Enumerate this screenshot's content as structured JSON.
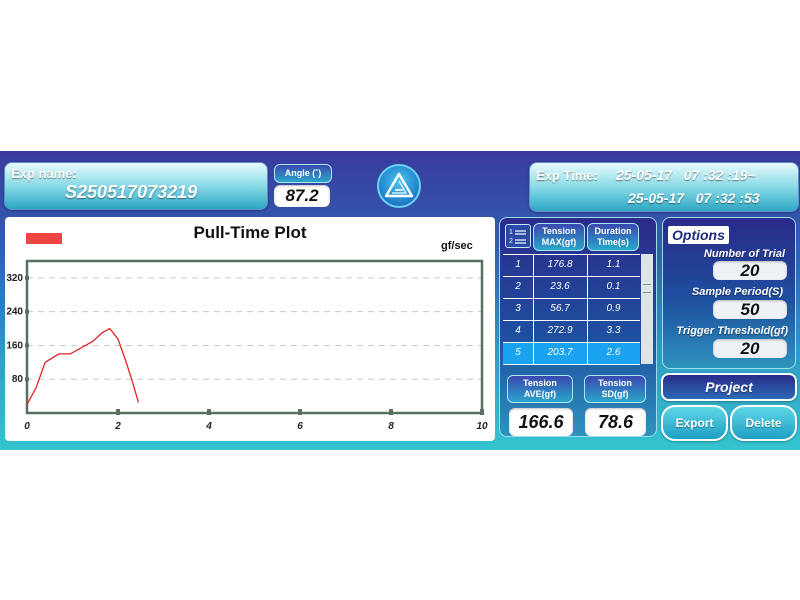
{
  "header": {
    "exp_name_label": "Exp name:",
    "exp_name_value": "S250517073219",
    "angle_label": "Angle (˚)",
    "angle_value": "87.2",
    "logo_icon": "triangle-logo-icon",
    "exp_time_label": "Exp Time:",
    "exp_time_start": "25-05-17   07 :32 :19~",
    "exp_time_end": "25-05-17   07 :32 :53"
  },
  "plot": {
    "title": "Pull-Time Plot",
    "unit": "gf/sec",
    "legend_color": "#ef4444",
    "line_color": "#e02424"
  },
  "chart_data": {
    "type": "line",
    "title": "Pull-Time Plot",
    "ylabel": "gf/sec",
    "xlim": [
      0,
      10
    ],
    "ylim": [
      0,
      360
    ],
    "x_ticks": [
      0,
      2,
      4,
      6,
      8,
      10
    ],
    "y_ticks": [
      80,
      160,
      240,
      320
    ],
    "grid": "horizontal dashed",
    "series": [
      {
        "x": [
          0,
          0.2,
          0.4,
          0.7,
          0.95,
          1.2,
          1.45,
          1.65,
          1.82,
          2.0,
          2.15,
          2.3,
          2.45
        ],
        "y": [
          20,
          60,
          120,
          140,
          140,
          155,
          170,
          190,
          200,
          175,
          130,
          80,
          25
        ]
      }
    ]
  },
  "table": {
    "header_icon": "list-icon",
    "columns": [
      "Tension MAX(gf)",
      "Duration Time(s)"
    ],
    "col1_line1": "Tension",
    "col1_line2": "MAX(gf)",
    "col2_line1": "Duration",
    "col2_line2": "Time(s)",
    "rows": [
      {
        "n": "1",
        "max": "176.8",
        "dur": "1.1"
      },
      {
        "n": "2",
        "max": "23.6",
        "dur": "0.1"
      },
      {
        "n": "3",
        "max": "56.7",
        "dur": "0.9"
      },
      {
        "n": "4",
        "max": "272.9",
        "dur": "3.3"
      },
      {
        "n": "5",
        "max": "203.7",
        "dur": "2.6"
      }
    ],
    "selected_row": 5,
    "scroll_icon": "scroll-grip-icon"
  },
  "stats": {
    "ave_label_1": "Tension",
    "ave_label_2": "AVE(gf)",
    "ave_value": "166.6",
    "sd_label_1": "Tension",
    "sd_label_2": "SD(gf)",
    "sd_value": "78.6"
  },
  "options": {
    "title": "Options",
    "trials_label": "Number of Trial",
    "trials_value": "20",
    "sample_label": "Sample Period(S)",
    "sample_value": "50",
    "trigger_label": "Trigger Threshold(gf)",
    "trigger_value": "20"
  },
  "buttons": {
    "project": "Project",
    "export": "Export",
    "delete": "Delete"
  }
}
